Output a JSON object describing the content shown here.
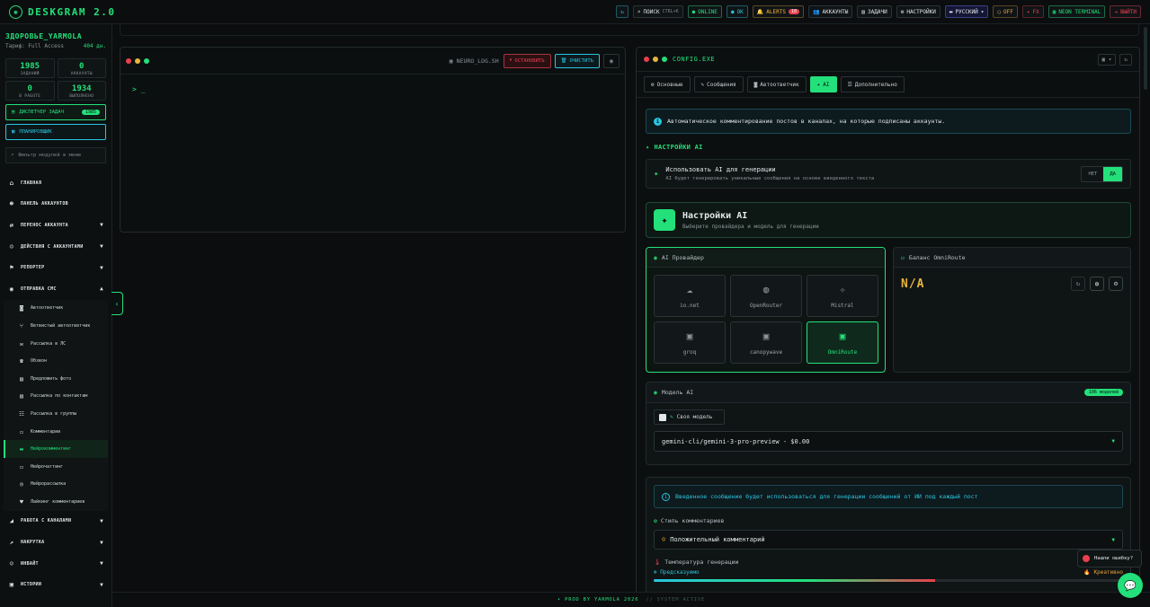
{
  "topbar": {
    "brand": "DESKGRAM 2.0",
    "logo_icon": "brain-icon",
    "search_label": "ПОИСК",
    "search_kbd": "CTRL+K",
    "online": "ONLINE",
    "ok": "OK",
    "alerts": "ALERTS",
    "alerts_count": "10",
    "accounts": "АККАУНТЫ",
    "tasks": "ЗАДАЧИ",
    "settings": "НАСТРОЙКИ",
    "lang": "РУССКИЙ",
    "off": "OFF",
    "fx": "FX",
    "neon": "NEON TERMINAL",
    "exit": "ВЫЙТИ"
  },
  "sidebar": {
    "user_name": "ЗДОРОВЬЕ_YARMOLA",
    "tariff": "Тариф: Full Access",
    "days": "404 дн.",
    "stats": [
      {
        "value": "1985",
        "label": "ЗАДАНИЙ"
      },
      {
        "value": "0",
        "label": "АККАУНТЫ"
      },
      {
        "value": "0",
        "label": "В РАБОТЕ"
      },
      {
        "value": "1934",
        "label": "ВЫПОЛНЕНО"
      }
    ],
    "dispatcher": "ДИСПЕТЧЕР ЗАДАЧ",
    "dispatcher_count": "1985",
    "planner": "ПЛАНИРОВЩИК",
    "filter_placeholder": "Фильтр модулей в меню",
    "nav": [
      {
        "label": "ГЛАВНАЯ"
      },
      {
        "label": "ПАНЕЛЬ АККАУНТОВ"
      },
      {
        "label": "ПЕРЕНОС АККАУНТА"
      },
      {
        "label": "ДЕЙСТВИЯ С АККАУНТАМИ"
      },
      {
        "label": "РЕПОРТЕР"
      },
      {
        "label": "ОТПРАВКА СМС"
      }
    ],
    "sub": [
      {
        "label": "Автоответчик"
      },
      {
        "label": "Ветвистый автоответчик"
      },
      {
        "label": "Рассылка в ЛС"
      },
      {
        "label": "Обзвон"
      },
      {
        "label": "Предложить фото"
      },
      {
        "label": "Рассылка по контактам"
      },
      {
        "label": "Рассылка в группы"
      },
      {
        "label": "Комментарии"
      },
      {
        "label": "Нейрокомментинг"
      },
      {
        "label": "Нейрочаттинг"
      },
      {
        "label": "Нейрорассылка"
      },
      {
        "label": "Лайкинг комментариев"
      }
    ],
    "nav2": [
      {
        "label": "РАБОТА С КАНАЛАМИ"
      },
      {
        "label": "НАКРУТКА"
      },
      {
        "label": "ИНВАЙТ"
      },
      {
        "label": "ИСТОРИИ"
      }
    ]
  },
  "terminal": {
    "title": "NEURO_LOG.SH",
    "stop": "ОСТАНОВИТЬ",
    "clear": "ОЧИСТИТЬ",
    "prompt": "> _"
  },
  "config": {
    "title": "CONFIG.EXE",
    "tabs": [
      {
        "label": "Основные"
      },
      {
        "label": "Сообщения"
      },
      {
        "label": "Автоответчик"
      },
      {
        "label": "AI"
      },
      {
        "label": "Дополнительно"
      }
    ],
    "info": "Автоматическое комментирование постов в каналах, на которые подписаны аккаунты.",
    "section_ai": "НАСТРОЙКИ AI",
    "use_ai_title": "Использовать AI для генерации",
    "use_ai_sub": "AI будет генерировать уникальные сообщения на основе введенного текста",
    "toggle_no": "НЕТ",
    "toggle_yes": "ДА",
    "ai_settings_title": "Настройки AI",
    "ai_settings_sub": "Выберите провайдера и модель для генерации",
    "provider_title": "AI Провайдер",
    "providers": [
      {
        "name": "io.net",
        "icon": "cloud-icon"
      },
      {
        "name": "OpenRouter",
        "icon": "globe-icon"
      },
      {
        "name": "Mistral",
        "icon": "sparkle-icon"
      },
      {
        "name": "groq",
        "icon": "chip-icon"
      },
      {
        "name": "canopywave",
        "icon": "chip-icon"
      },
      {
        "name": "OmniRoute",
        "icon": "chip-icon"
      }
    ],
    "balance_title": "Баланс OmniRoute",
    "balance_value": "N/A",
    "model_title": "Модель AI",
    "model_count": "106 моделей",
    "own_model": "Своя модель",
    "model_selected": "gemini-cli/gemini-3-pro-preview - $0.00",
    "prompt_info": "Введенное сообщение будет использоваться для генерации сообщений от ИИ под каждый пост",
    "style_label": "Стиль комментариев",
    "style_value": "Положительный комментарий",
    "temp_label": "Температура генерации",
    "temp_low": "Предсказуемо",
    "temp_high": "Креативно",
    "temp_fill_fraction": 0.6
  },
  "footer": {
    "left": "• PROD BY YARMOLA 2026",
    "right": "// SYSTEM ACTIVE"
  },
  "floating": {
    "bug": "Нашли ошибку?"
  },
  "colors": {
    "accent": "#23e07a",
    "cyan": "#2bc5e0",
    "danger": "#e8404d",
    "warn": "#e8b43c"
  }
}
